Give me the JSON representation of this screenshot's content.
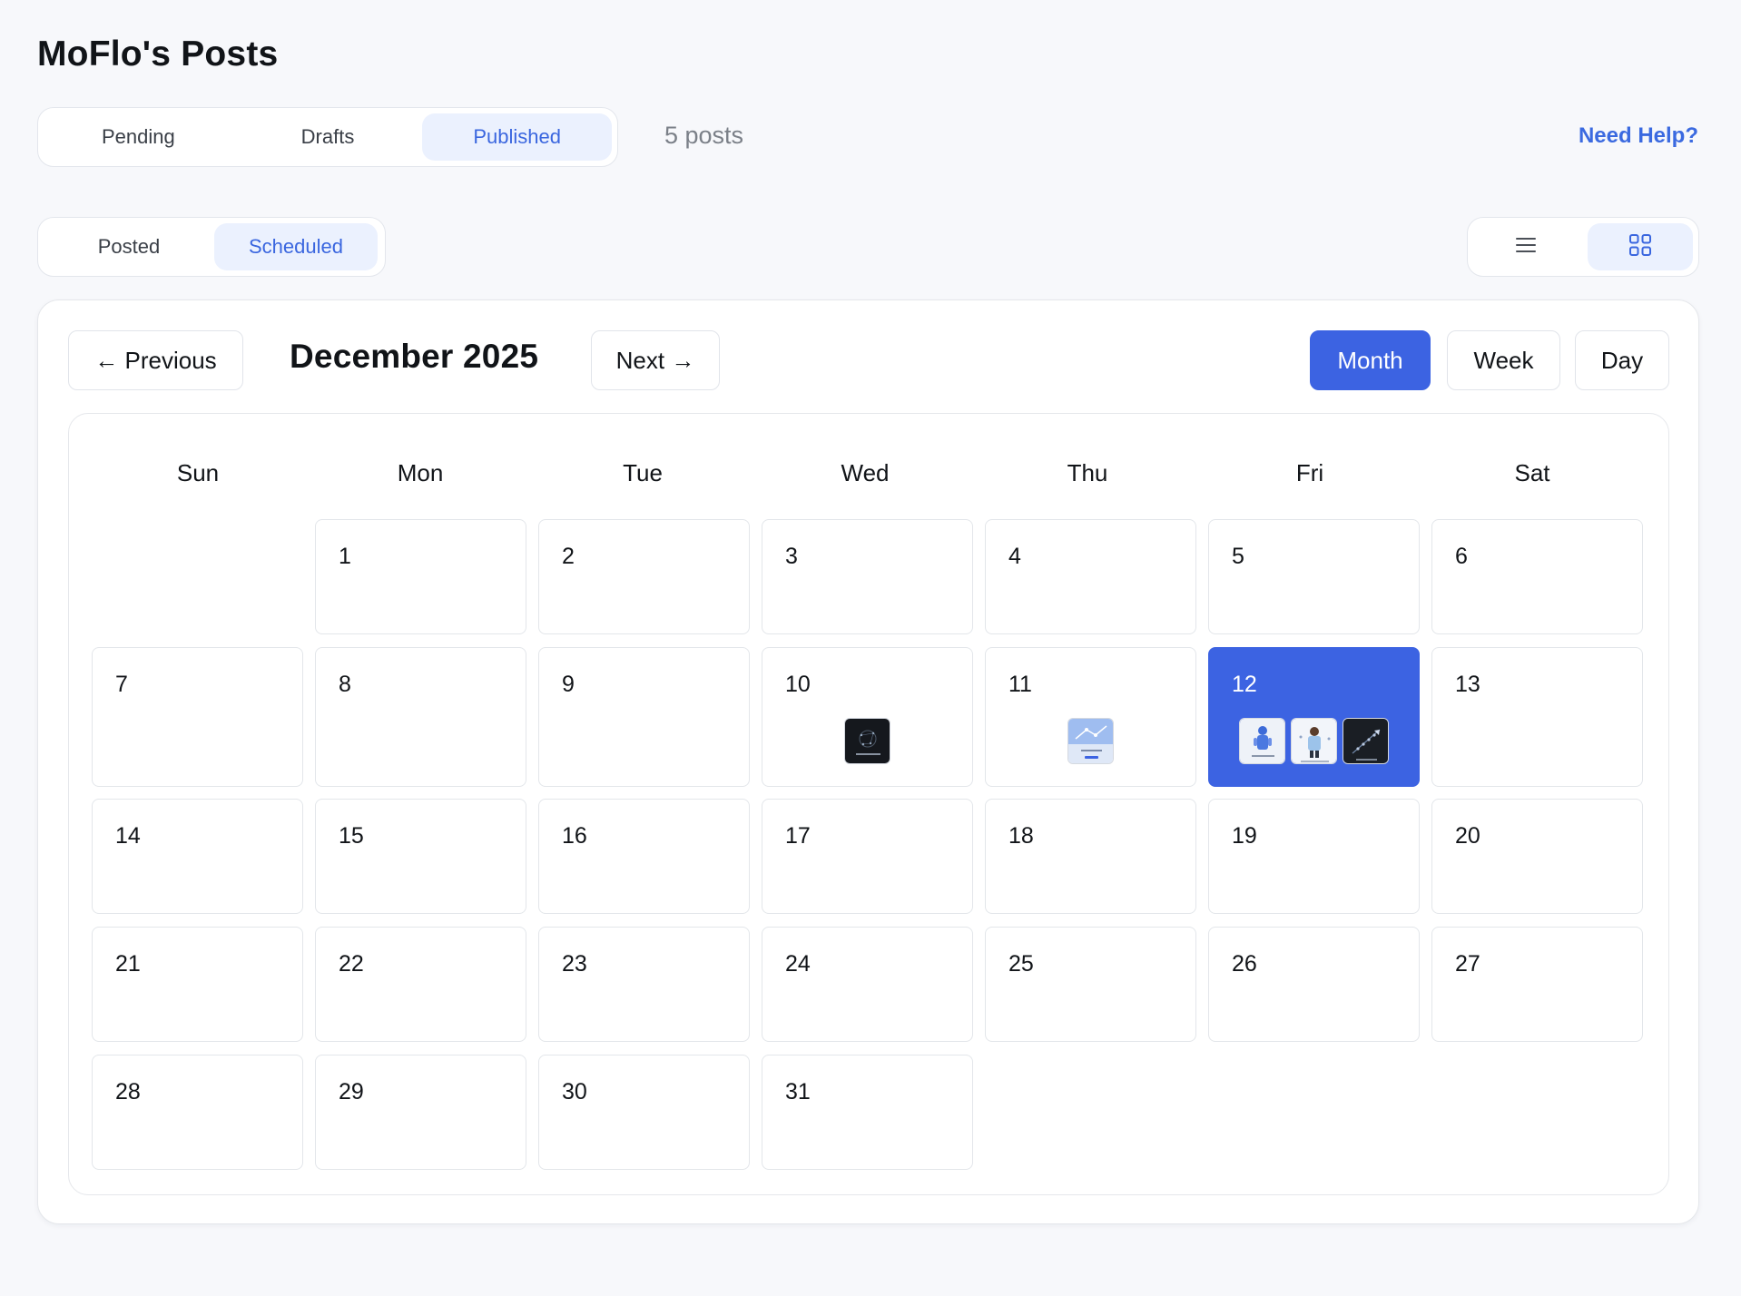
{
  "header": {
    "title": "MoFlo's Posts",
    "post_count": "5 posts",
    "help_link": "Need Help?"
  },
  "status_tabs": [
    {
      "label": "Pending",
      "active": false
    },
    {
      "label": "Drafts",
      "active": false
    },
    {
      "label": "Published",
      "active": true
    }
  ],
  "sub_tabs": [
    {
      "label": "Posted",
      "active": false
    },
    {
      "label": "Scheduled",
      "active": true
    }
  ],
  "view_toggle": {
    "options": [
      "list-icon",
      "grid-icon"
    ],
    "active": "grid-icon"
  },
  "calendar": {
    "prev_label": "← Previous",
    "next_label": "Next →",
    "month_label": "December 2025",
    "modes": [
      "Month",
      "Week",
      "Day"
    ],
    "active_mode": "Month",
    "weekdays": [
      "Sun",
      "Mon",
      "Tue",
      "Wed",
      "Thu",
      "Fri",
      "Sat"
    ],
    "days": [
      "1",
      "2",
      "3",
      "4",
      "5",
      "6",
      "7",
      "8",
      "9",
      "10",
      "11",
      "12",
      "13",
      "14",
      "15",
      "16",
      "17",
      "18",
      "19",
      "20",
      "21",
      "22",
      "23",
      "24",
      "25",
      "26",
      "27",
      "28",
      "29",
      "30",
      "31"
    ],
    "selected_day": "12",
    "scheduled_posts": [
      {
        "day": "10",
        "thumbnail": "dark-network-thumbnail"
      },
      {
        "day": "11",
        "thumbnail": "light-blue-diagram-thumbnail"
      },
      {
        "day": "12",
        "thumbnail": "blue-figure-thumbnail"
      },
      {
        "day": "12",
        "thumbnail": "person-portrait-thumbnail"
      },
      {
        "day": "12",
        "thumbnail": "dark-rocket-thumbnail"
      }
    ]
  },
  "colors": {
    "accent": "#3c63e2",
    "link": "#3b6ae0",
    "active_tab_bg": "#ebf1fe",
    "page_bg": "#f7f8fb"
  }
}
